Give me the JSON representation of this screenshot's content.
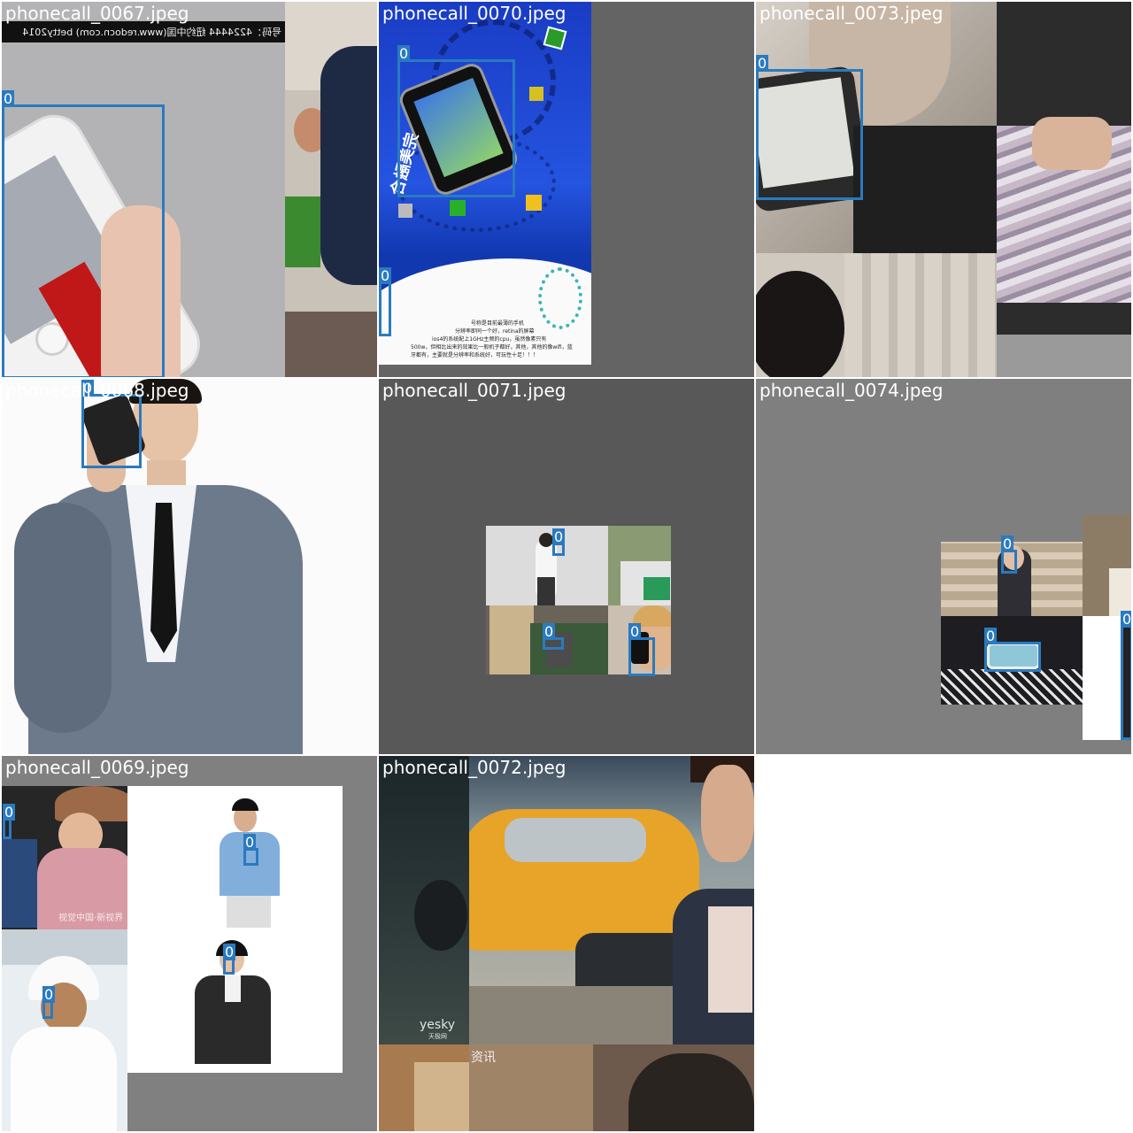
{
  "grid": {
    "tiles": [
      {
        "title": "phonecall_0067.jpeg",
        "boxes": [
          {
            "label": "0"
          }
        ],
        "texts": [
          "号码：4224444  纽约中国(www.redocn.com)  betty2014"
        ]
      },
      {
        "title": "phonecall_0070.jpeg",
        "boxes": [
          {
            "label": "0"
          },
          {
            "label": "0"
          }
        ],
        "texts": [
          "完美融合",
          "号称是目前最薄的手机",
          "分辨率即同一个好，retina的屏幕",
          "ios4的系统配上1GHz主频的cpu，虽然像素只有",
          "500w，但相比出来的效果比一般机子都好，其他，其他的像wifi，蓝",
          "牙都有，主要就是分辨率和系统好，可玩性十足！！！"
        ]
      },
      {
        "title": "phonecall_0073.jpeg",
        "boxes": [
          {
            "label": "0"
          }
        ],
        "texts": []
      },
      {
        "title": "phonecall_0068.jpeg",
        "boxes": [
          {
            "label": "0"
          }
        ],
        "texts": []
      },
      {
        "title": "phonecall_0071.jpeg",
        "boxes": [
          {
            "label": "0"
          },
          {
            "label": "0"
          },
          {
            "label": "0"
          }
        ],
        "texts": []
      },
      {
        "title": "phonecall_0074.jpeg",
        "boxes": [
          {
            "label": "0"
          },
          {
            "label": "0"
          },
          {
            "label": "0"
          }
        ],
        "texts": []
      },
      {
        "title": "phonecall_0069.jpeg",
        "boxes": [
          {
            "label": "0"
          },
          {
            "label": "0"
          },
          {
            "label": "0"
          },
          {
            "label": "0"
          }
        ],
        "texts": [
          "视觉中国·新视界"
        ]
      },
      {
        "title": "phonecall_0072.jpeg",
        "boxes": [],
        "texts": [
          "yesky",
          "天极网",
          "资讯"
        ]
      }
    ]
  },
  "colors": {
    "box": "#2a7ac0",
    "mosaic_padding": "#7f7f7f",
    "label_text": "#ffffff"
  }
}
